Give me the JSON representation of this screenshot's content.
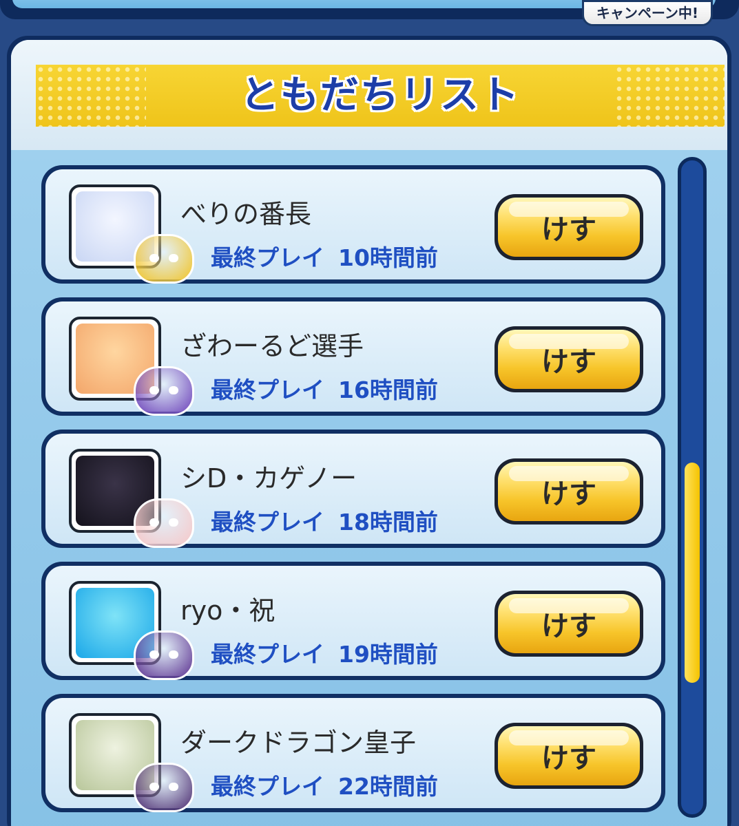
{
  "campaign_tag": "キャンペーン中!",
  "title": "ともだちリスト",
  "friends": [
    {
      "name": "べりの番長",
      "last_play_label": "最終プレイ",
      "last_play_time": "10時間前",
      "delete_label": "けす",
      "avatar_colors": [
        "#f3f6ff",
        "#c9d6f4"
      ],
      "badge_color": "#f2c322"
    },
    {
      "name": "ざわーるど選手",
      "last_play_label": "最終プレイ",
      "last_play_time": "16時間前",
      "delete_label": "けす",
      "avatar_colors": [
        "#ffd6a0",
        "#f3a66a"
      ],
      "badge_color": "#6b3fb8"
    },
    {
      "name": "シD・カゲノー",
      "last_play_label": "最終プレイ",
      "last_play_time": "18時間前",
      "delete_label": "けす",
      "avatar_colors": [
        "#3a3348",
        "#14121c"
      ],
      "badge_color": "#f7c7c7"
    },
    {
      "name": "ryo・祝",
      "last_play_label": "最終プレイ",
      "last_play_time": "19時間前",
      "delete_label": "けす",
      "avatar_colors": [
        "#7fe3f7",
        "#1aa7e8"
      ],
      "badge_color": "#5a2f8e"
    },
    {
      "name": "ダークドラゴン皇子",
      "last_play_label": "最終プレイ",
      "last_play_time": "22時間前",
      "delete_label": "けす",
      "avatar_colors": [
        "#eef2e0",
        "#b8c69a"
      ],
      "badge_color": "#4a2a6e"
    }
  ],
  "scroll_position": 0.68
}
